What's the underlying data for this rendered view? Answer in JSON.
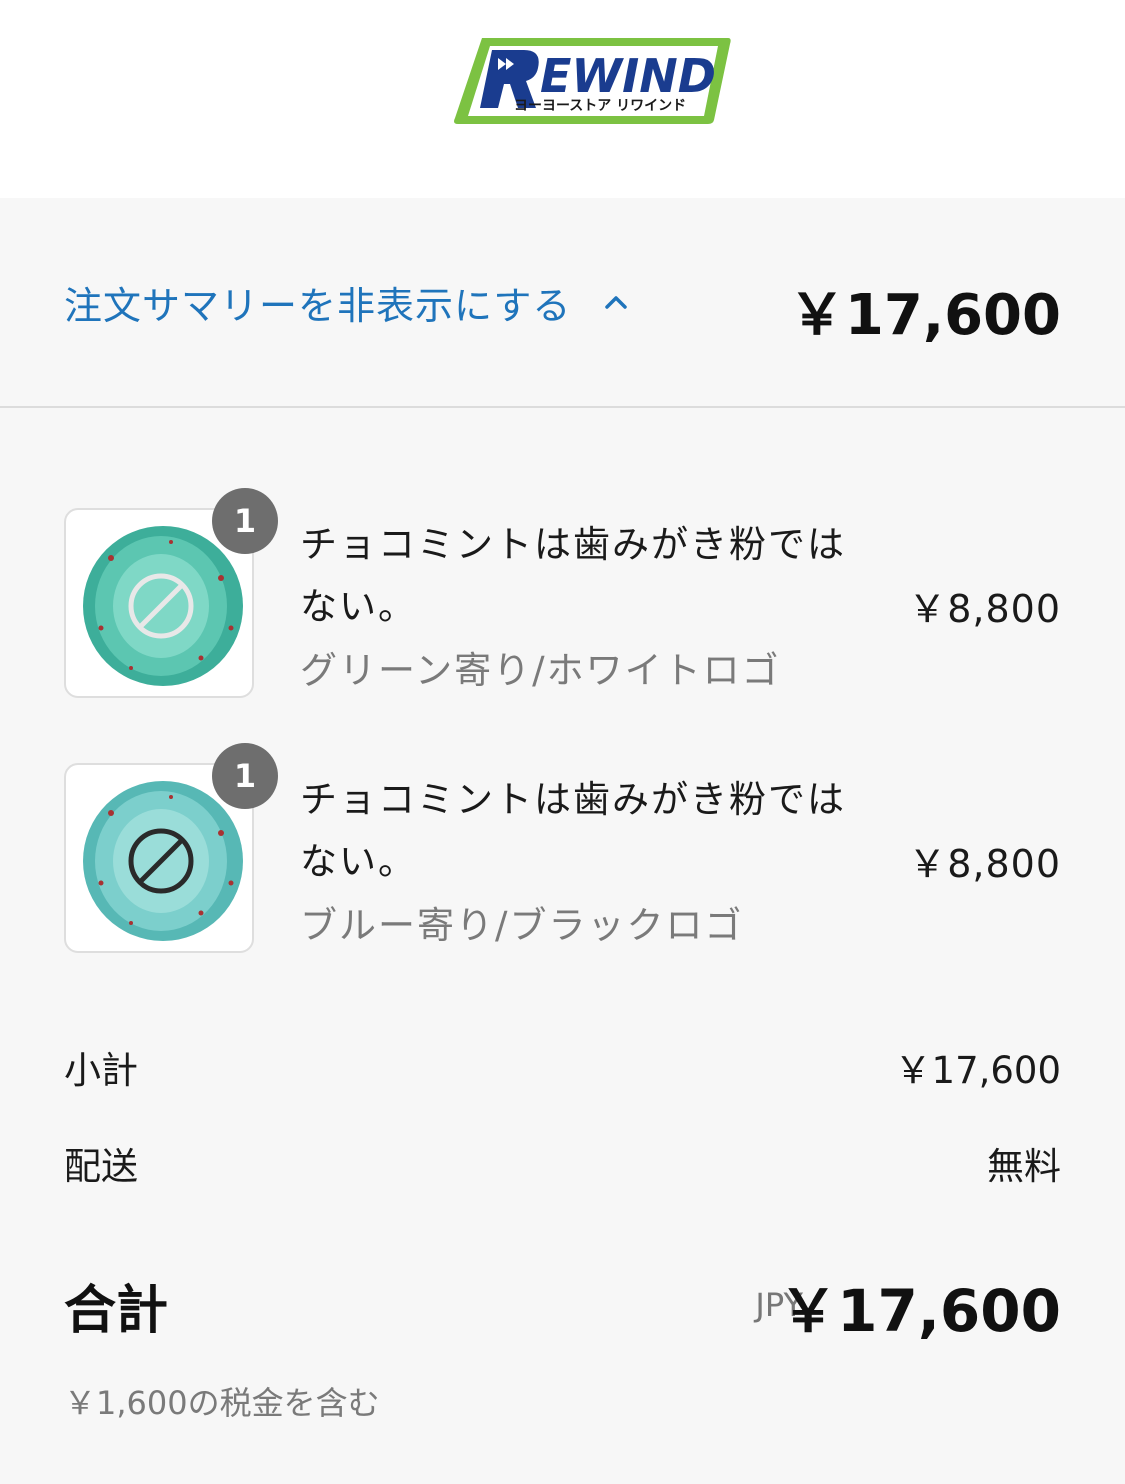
{
  "brand": {
    "logo_text": "REWIND",
    "logo_subtext": "ヨーヨーストア リワインド",
    "colors": {
      "green": "#7cc242",
      "blue": "#1a3c8f"
    }
  },
  "summary_toggle": {
    "label": "注文サマリーを非表示にする",
    "chevron_icon": "chevron-up-icon",
    "total": "￥17,600"
  },
  "items": [
    {
      "quantity": "1",
      "name": "チョコミントは歯みがき粉ではない。",
      "variant": "グリーン寄り/ホワイトロゴ",
      "price": "￥8,800"
    },
    {
      "quantity": "1",
      "name": "チョコミントは歯みがき粉ではない。",
      "variant": "ブルー寄り/ブラックロゴ",
      "price": "￥8,800"
    }
  ],
  "totals": {
    "subtotal_label": "小計",
    "subtotal_value": "￥17,600",
    "shipping_label": "配送",
    "shipping_value": "無料",
    "total_label": "合計",
    "currency": "JPY",
    "total_value": "￥17,600",
    "tax_note": "￥1,600の税金を含む"
  },
  "colors": {
    "link": "#1f74bb",
    "badge": "#6e6e6e"
  }
}
